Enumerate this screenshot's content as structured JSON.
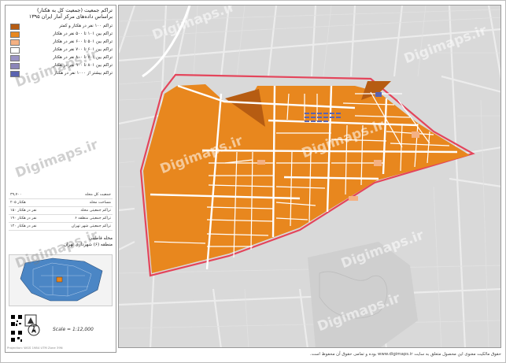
{
  "sidebar": {
    "title_line1": "تراکم جمعیت (جمعیت کل به هکتار)",
    "title_line2": "براساس داده‌های مرکز آمار ایران ۱۳۹۵",
    "legend": [
      {
        "label": "تراکم ۱۰۰ نفر در هکتار و کمتر",
        "color": "#b65c12"
      },
      {
        "label": "تراکم بین ۱۰۱ تا ۵۰۰ نفر در هکتار",
        "color": "#e8871e"
      },
      {
        "label": "تراکم بین ۵۰۱ تا ۶۰۰ نفر در هکتار",
        "color": "#f4b183"
      },
      {
        "label": "تراکم بین ۶۰۱ تا ۷۰۰ نفر در هکتار",
        "color": "#ffffff"
      },
      {
        "label": "تراکم بین ۷۰۱ تا ۸۰۰ نفر در هکتار",
        "color": "#9a93c4"
      },
      {
        "label": "تراکم بین ۸۰۱ تا ۹۰۰ نفر در هکتار",
        "color": "#8c86b8"
      },
      {
        "label": "تراکم بیشتر از ۱۰۰۰ نفر در هکتار",
        "color": "#5a63b0"
      }
    ],
    "stats": [
      {
        "label": "جمعیت کل محله",
        "value": "۳۹,۷۰۰"
      },
      {
        "label": "مساحت محله",
        "value": "۲۰۵ هکتار"
      },
      {
        "label": "تراکم جمعیتی محله",
        "value": "۱۵۰ نفر در هکتار"
      },
      {
        "label": "تراکم جمعیتی منطقه ۶",
        "value": "۱۹۰ نفر در هکتار"
      },
      {
        "label": "تراکم جمعیتی شهر تهران",
        "value": "۱۴۰ نفر در هکتار"
      }
    ],
    "region_line1": "محله فاطمی",
    "region_line2": "منطقه (۶) شهرداری تهران",
    "scale": "Scale = 1:12,000",
    "credit": "Projection: WGS 1984 UTM Zone 39N"
  },
  "footer": "حقوق مالکیت معنوی این محصول متعلق به سایت www.digimaps.ir بوده و تمامی حقوق آن محفوظ است.",
  "watermark": "Digimaps.ir",
  "colors": {
    "map_bg": "#d9d9d9",
    "district_fill": "#e8871e",
    "district_dark": "#b65c12",
    "district_border": "#e4455b",
    "street": "#ffffff",
    "blue_block": "#5a63b0"
  }
}
